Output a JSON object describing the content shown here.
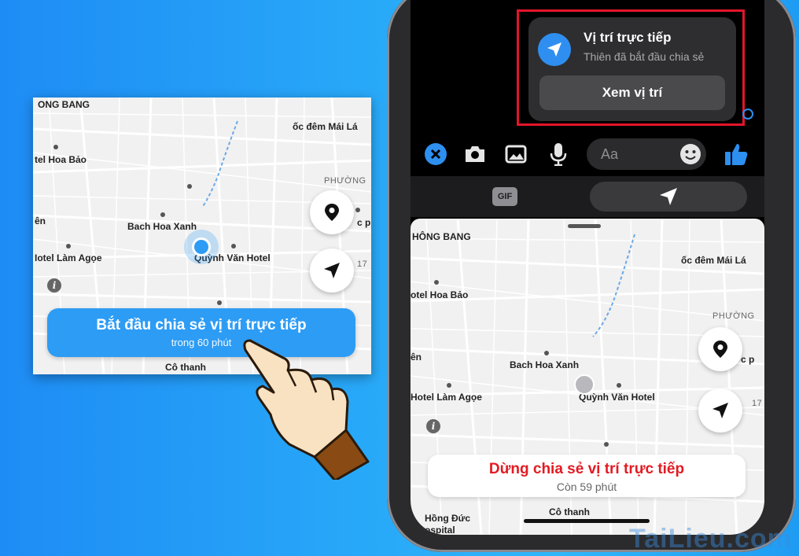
{
  "left_map": {
    "labels": {
      "ong_bang": "ONG BANG",
      "oc_dem": "ốc đêm Mái Lá",
      "tel_hoa_bao": "tel Hoa Bảo",
      "phuong": "PHƯỜNG",
      "en": "ên",
      "bach_hoa_xanh": "Bach Hoa Xanh",
      "hotel_lam_agoe": "Iotel Làm Agọe",
      "quynh_van_hotel": "Quỳnh Văn Hotel",
      "co_thanh": "Cô thanh",
      "num_17": "17",
      "cp": "c p"
    },
    "share_button": {
      "title": "Bắt đầu chia sẻ vị trí trực tiếp",
      "subtitle": "trong 60 phút"
    }
  },
  "notification": {
    "title": "Vị trí trực tiếp",
    "subtitle": "Thiên đã bắt đầu chia sẻ",
    "view_button": "Xem vị trí"
  },
  "composer": {
    "placeholder": "Aa",
    "gif_label": "GIF"
  },
  "right_map": {
    "labels": {
      "hong_bang": "HÔNG BANG",
      "oc_dem": "ốc đêm Mái Lá",
      "tel_hoa_bao": "otel Hoa Bảo",
      "phuong": "PHƯỜNG",
      "en": "ên",
      "bach_hoa_xanh": "Bach Hoa Xanh",
      "hotel_lam_agoe": "Hotel Làm Agọe",
      "quynh_van_hotel": "Quỳnh Văn Hotel",
      "hong_duc": "Hồng Đức",
      "hospital": "ospital",
      "co_thanh": "Cô thanh",
      "num_17": "17",
      "cp": "c p"
    },
    "stop_button": {
      "title": "Dừng chia sẻ vị trí trực tiếp",
      "subtitle": "Còn 59 phút"
    }
  },
  "watermark": "TaiLieu.com",
  "colors": {
    "messenger_blue": "#2d9cf5",
    "stop_red": "#e31b23",
    "highlight_red": "#e3152a"
  }
}
